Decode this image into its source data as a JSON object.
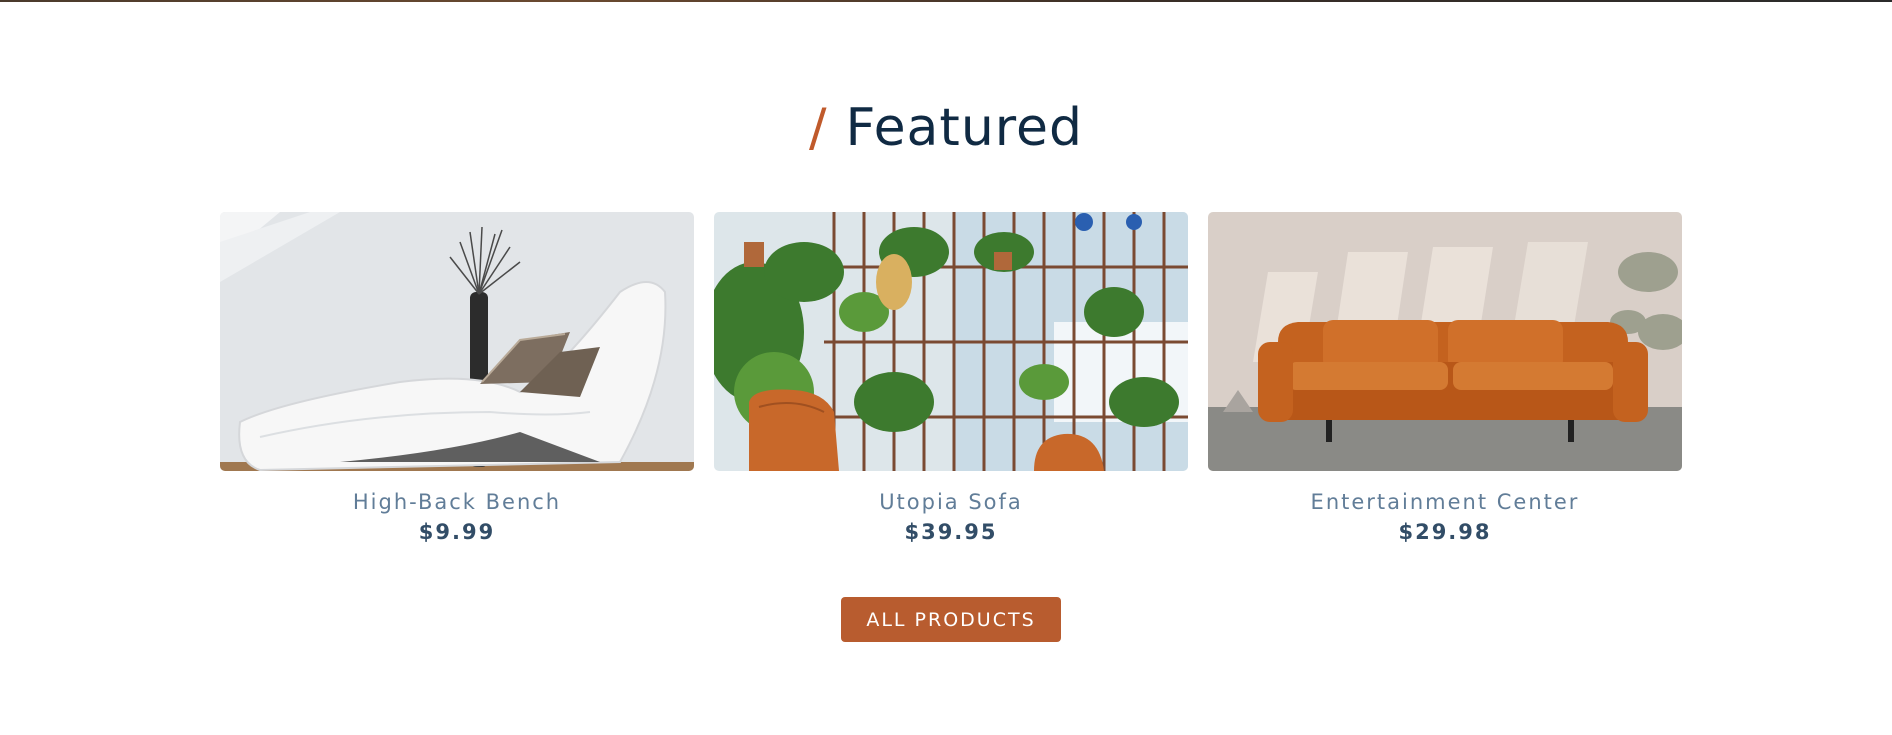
{
  "section": {
    "slash": "/",
    "title": "Featured"
  },
  "products": [
    {
      "name": "High-Back Bench",
      "price": "$9.99",
      "image_subject": "white leather chaise lounge with striped pillows and vase"
    },
    {
      "name": "Utopia Sofa",
      "price": "$39.95",
      "image_subject": "plant shelving with orange leather chairs"
    },
    {
      "name": "Entertainment Center",
      "price": "$29.98",
      "image_subject": "orange leather sofa in sunlit room"
    }
  ],
  "cta": {
    "label": "ALL PRODUCTS"
  },
  "colors": {
    "accent": "#c05a2b",
    "button": "#b85c2f",
    "title": "#102a43",
    "product_name": "#617d98",
    "product_price": "#324d67"
  }
}
